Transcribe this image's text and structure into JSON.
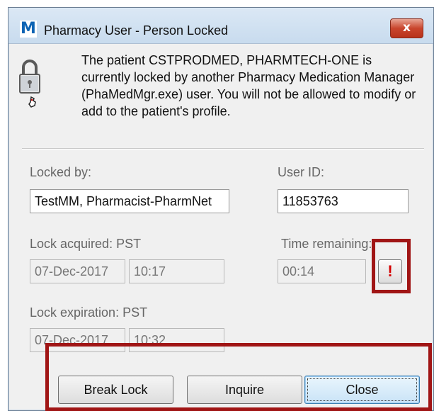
{
  "window": {
    "title": "Pharmacy User - Person Locked",
    "app_icon_letter": "M",
    "close_glyph": "x"
  },
  "message": "The patient CSTPRODMED, PHARMTECH-ONE is currently locked by another Pharmacy Medication Manager (PhaMedMgr.exe) user.  You will not be allowed to modify or add to the patient's profile.",
  "fields": {
    "locked_by_label": "Locked by:",
    "locked_by_value": "TestMM, Pharmacist-PharmNet",
    "user_id_label": "User ID:",
    "user_id_value": "11853763",
    "lock_acquired_label": "Lock acquired: PST",
    "lock_acquired_date": "07-Dec-2017",
    "lock_acquired_time": "10:17",
    "time_remaining_label": "Time remaining:",
    "time_remaining_value": "00:14",
    "lock_expiration_label": "Lock expiration: PST",
    "lock_expiration_date": "07-Dec-2017",
    "lock_expiration_time": "10:32"
  },
  "alert_glyph": "!",
  "buttons": {
    "break_lock": "Break Lock",
    "inquire": "Inquire",
    "close": "Close"
  },
  "icons": [
    "lock-icon",
    "alert-icon",
    "close-icon"
  ],
  "colors": {
    "highlight": "#a01515",
    "titlebar": "#c8dbee",
    "close_button": "#c9452d"
  }
}
